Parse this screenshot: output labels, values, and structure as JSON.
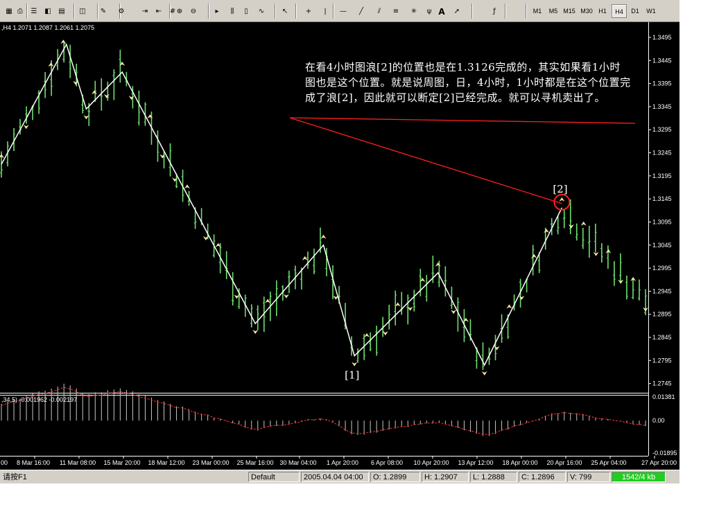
{
  "toolbar": {
    "icons": [
      "new-chart-icon",
      "print-icon",
      "market-watch-icon",
      "navigator-icon",
      "terminal-icon",
      "strategy-tester-icon",
      "properties-icon",
      "expert-advisors-icon",
      "autoscroll-icon",
      "chart-shift-icon",
      "grid-icon",
      "zoom-in-icon",
      "zoom-out-icon",
      "cursor-icon",
      "bar-chart-icon",
      "candle-chart-icon",
      "line-chart-icon",
      "pointer-icon",
      "crosshair-icon",
      "vertical-line-icon",
      "horizontal-line-icon",
      "trend-line-icon",
      "channel-icon",
      "fibonacci-icon",
      "gann-icon",
      "fork-icon",
      "text-icon",
      "arrow-icon",
      "period-icon"
    ],
    "text_icon_label": "A",
    "timeframes": [
      "M1",
      "M5",
      "M15",
      "M30",
      "H1",
      "H4",
      "D1",
      "W1"
    ],
    "active_timeframe": "H4"
  },
  "chart": {
    "header": ",H4  1.2071 1.2087 1.2061 1.2075",
    "indicator_header": ",34,5)  -0.001962  -0.002197",
    "annotation": "在看4小时图浪[2]的位置也是在1.3126完成的，其实如果看1小时图也是这个位置。就是说周图，日，4小时，1小时都是在这个位置完成了浪[2]，因此就可以断定[2]已经完成。就可以寻机卖出了。",
    "wave_label_1": "[1]",
    "wave_label_2": "[2]",
    "colors": {
      "background": "#000000",
      "bars": "#6fe06f",
      "zigzag": "#ffffff",
      "annotation_line": "#ff2020",
      "signal": "#ff3030",
      "fractal": "#f5e8a0"
    }
  },
  "chart_data": {
    "type": "bar",
    "symbol_timeframe": "H4",
    "price_ticks": [
      "1.3495",
      "1.3445",
      "1.3395",
      "1.3345",
      "1.3295",
      "1.3245",
      "1.3195",
      "1.3145",
      "1.3095",
      "1.3045",
      "1.2995",
      "1.2945",
      "1.2895",
      "1.2845",
      "1.2795",
      "1.2745"
    ],
    "ylim": [
      1.2725,
      1.3525
    ],
    "indicator_ticks": [
      "0.01381",
      "0.00",
      "-0.01895"
    ],
    "indicator_ylim": [
      -0.01895,
      0.01381
    ],
    "x_ticks": [
      "00",
      "8 Mar 16:00",
      "11 Mar 08:00",
      "15 Mar 20:00",
      "18 Mar 12:00",
      "23 Mar 00:00",
      "25 Mar 16:00",
      "30 Mar 04:00",
      "1 Apr 20:00",
      "6 Apr 08:00",
      "10 Apr 20:00",
      "13 Apr 12:00",
      "18 Apr 00:00",
      "20 Apr 16:00",
      "25 Apr 04:00",
      "27 Apr 20:00"
    ],
    "zigzag": [
      {
        "x": 0.0,
        "y": 1.322
      },
      {
        "x": 10.5,
        "y": 1.348
      },
      {
        "x": 13.7,
        "y": 1.334
      },
      {
        "x": 19.5,
        "y": 1.342
      },
      {
        "x": 41.0,
        "y": 1.2875
      },
      {
        "x": 52.0,
        "y": 1.3045
      },
      {
        "x": 57.0,
        "y": 1.2805
      },
      {
        "x": 70.5,
        "y": 1.2985
      },
      {
        "x": 78.0,
        "y": 1.2785
      },
      {
        "x": 90.5,
        "y": 1.3126
      }
    ],
    "wave_points": [
      {
        "label": "[1]",
        "x": 57.0,
        "y": 1.2805
      },
      {
        "label": "[2]",
        "x": 90.5,
        "y": 1.3126
      }
    ],
    "bar_count": 104,
    "trend_line_end_price": 1.3126
  },
  "statusbar": {
    "help": "请按F1",
    "profile": "Default",
    "time": "2005.04.04 04:00",
    "open": "O: 1.2899",
    "high": "H: 1.2907",
    "low": "L: 1.2888",
    "close": "C: 1.2896",
    "volume": "V: 799",
    "traffic": "1542/4 kb"
  }
}
